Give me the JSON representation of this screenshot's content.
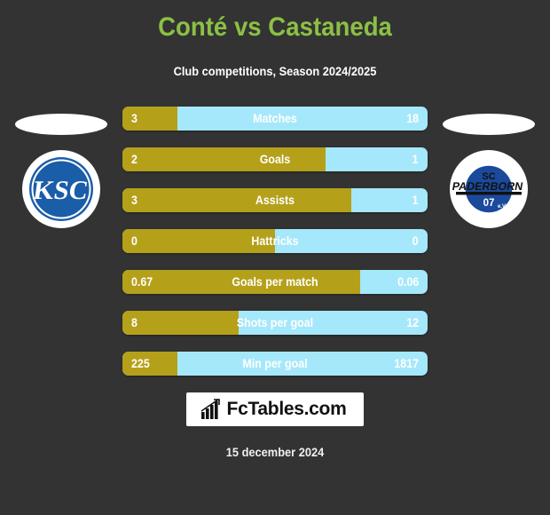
{
  "header": {
    "title": "Conté vs Castaneda",
    "subtitle": "Club competitions, Season 2024/2025"
  },
  "teams": {
    "home": {
      "crest_name": "karlsruher-sc-crest",
      "abbr": "KSC"
    },
    "away": {
      "crest_name": "sc-paderborn-07-crest",
      "line1": "SC",
      "line2": "PADERBORN",
      "line3": "07",
      "line4": "e.V."
    }
  },
  "stats": [
    {
      "label": "Matches",
      "home": "3",
      "away": "18",
      "home_pct": 18.0
    },
    {
      "label": "Goals",
      "home": "2",
      "away": "1",
      "home_pct": 66.7
    },
    {
      "label": "Assists",
      "home": "3",
      "away": "1",
      "home_pct": 75.0
    },
    {
      "label": "Hattricks",
      "home": "0",
      "away": "0",
      "home_pct": 50.0
    },
    {
      "label": "Goals per match",
      "home": "0.67",
      "away": "0.06",
      "home_pct": 78.0
    },
    {
      "label": "Shots per goal",
      "home": "8",
      "away": "12",
      "home_pct": 38.0
    },
    {
      "label": "Min per goal",
      "home": "225",
      "away": "1817",
      "home_pct": 18.0
    }
  ],
  "footer": {
    "brand": "FcTables.com",
    "brand_icon": "bar-chart-icon",
    "date": "15 december 2024"
  },
  "colors": {
    "background": "#333333",
    "title": "#8CC044",
    "bar_home": "#B5A01A",
    "bar_away": "#A5E8FB",
    "text": "#FFFFFF"
  }
}
